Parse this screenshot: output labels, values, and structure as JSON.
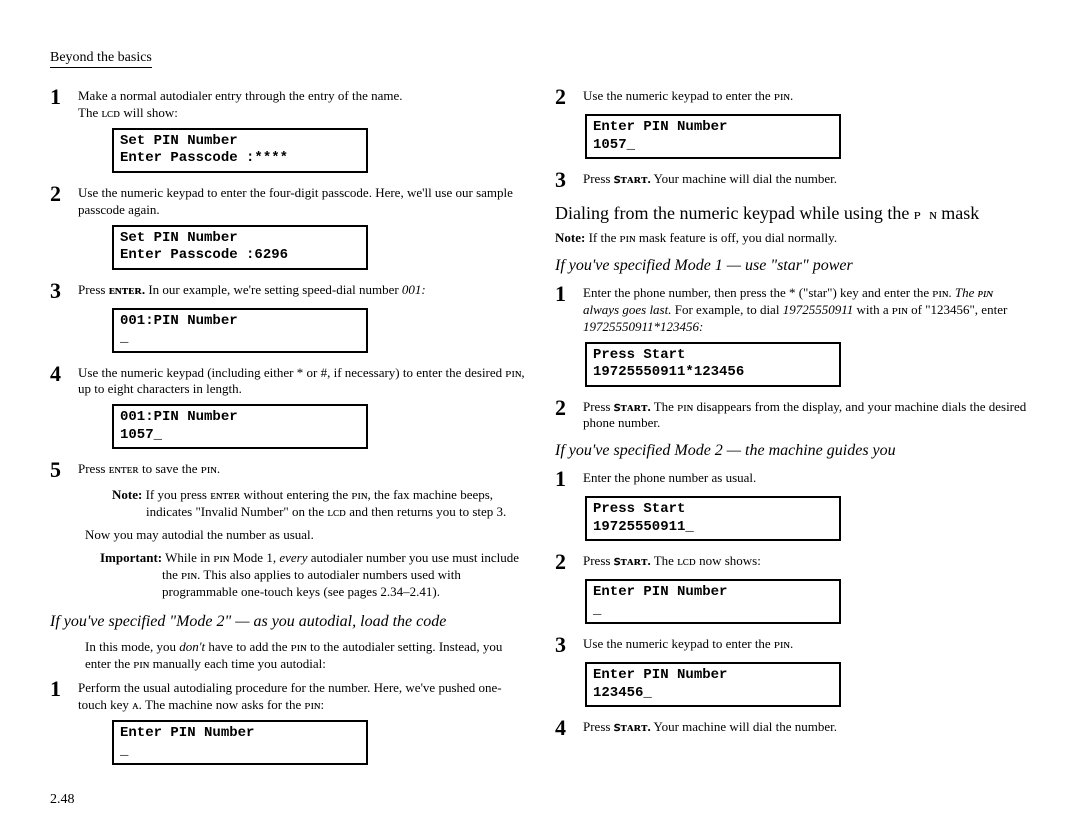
{
  "header": "Beyond the basics",
  "page_number": "2.48",
  "left": {
    "step1": "Make a normal autodialer entry through the entry of the name.",
    "step1_sub": "The ʟᴄᴅ will show:",
    "lcd1_line1": "Set PIN Number",
    "lcd1_line2": "Enter Passcode :****",
    "step2": "Use the numeric keypad to enter the four-digit passcode. Here, we'll use our sample passcode again.",
    "lcd2_line1": "Set PIN Number",
    "lcd2_line2": "Enter Passcode :6296",
    "step3_pre": "Press ",
    "step3_key": "ᴇɴᴛᴇʀ.",
    "step3_rest": " In our example, we're setting speed-dial number ",
    "step3_ital": "001:",
    "lcd3_line1": "001:PIN Number",
    "lcd3_line2": "_",
    "step4": "Use the numeric keypad (including either * or #, if necessary) to enter the desired ᴘɪɴ, up to eight characters in length.",
    "lcd4_line1": "001:PIN Number",
    "lcd4_line2": "1057_",
    "step5": "Press ᴇɴᴛᴇʀ to save the ᴘɪɴ.",
    "note1": "If you press ᴇɴᴛᴇʀ without entering the ᴘɪɴ, the fax machine beeps, indicates \"Invalid Number\" on the ʟᴄᴅ and then returns you to step 3.",
    "nowline": "Now you may autodial the number as usual.",
    "important": "While in ᴘɪɴ Mode 1, every autodialer number you use must include the ᴘɪɴ. This also applies to autodialer numbers used with programmable one-touch keys (see pages 2.34–2.41).",
    "mode2_heading": "If you've specified \"Mode 2\" — as you autodial, load the code",
    "mode2_intro": "In this mode, you don't have to add the ᴘɪɴ to the autodialer setting. Instead, you enter the ᴘɪɴ manually each time you autodial:",
    "mode2_step1": "Perform the usual autodialing procedure for the number. Here, we've pushed one-touch key ᴀ. The machine now asks for the ᴘɪɴ:",
    "lcd5_line1": "Enter PIN Number",
    "lcd5_line2": "_"
  },
  "right": {
    "step2": "Use the numeric keypad to enter the ᴘɪɴ.",
    "lcd1_line1": "Enter PIN Number",
    "lcd1_line2": "1057_",
    "step3": "Press ꜱᴛᴀʀᴛ. Your machine will dial the number.",
    "big_heading_pre": "Dialing from the numeric keypad while using the ",
    "big_heading_sc": "ᴘɪɴ",
    "big_heading_post": " mask",
    "note": "If the ᴘɪɴ mask feature is off, you dial normally.",
    "mode1_heading": "If you've specified Mode 1 — use \"star\" power",
    "m1_step1_a": "Enter the phone number, then press the * (\"star\") key and enter the ᴘɪɴ. ",
    "m1_step1_ital": "The ᴘɪɴ always goes last.",
    "m1_step1_b": " For example, to dial ",
    "m1_step1_num1": "19725550911",
    "m1_step1_c": " with a ᴘɪɴ of \"123456\", enter ",
    "m1_step1_num2": "19725550911*123456:",
    "lcd2_line1": "Press Start",
    "lcd2_line2": "19725550911*123456",
    "m1_step2": "Press ꜱᴛᴀʀᴛ. The ᴘɪɴ disappears from the display, and your machine dials the desired phone number.",
    "mode2_heading": "If you've specified Mode 2 — the machine guides you",
    "m2_step1": "Enter the phone number as usual.",
    "lcd3_line1": "Press Start",
    "lcd3_line2": "19725550911_",
    "m2_step2": "Press ꜱᴛᴀʀᴛ. The ʟᴄᴅ now shows:",
    "lcd4_line1": "Enter PIN Number",
    "lcd4_line2": "_",
    "m2_step3": "Use the numeric keypad to enter the ᴘɪɴ.",
    "lcd5_line1": "Enter PIN Number",
    "lcd5_line2": "123456_",
    "m2_step4": "Press ꜱᴛᴀʀᴛ. Your machine will dial the number."
  }
}
